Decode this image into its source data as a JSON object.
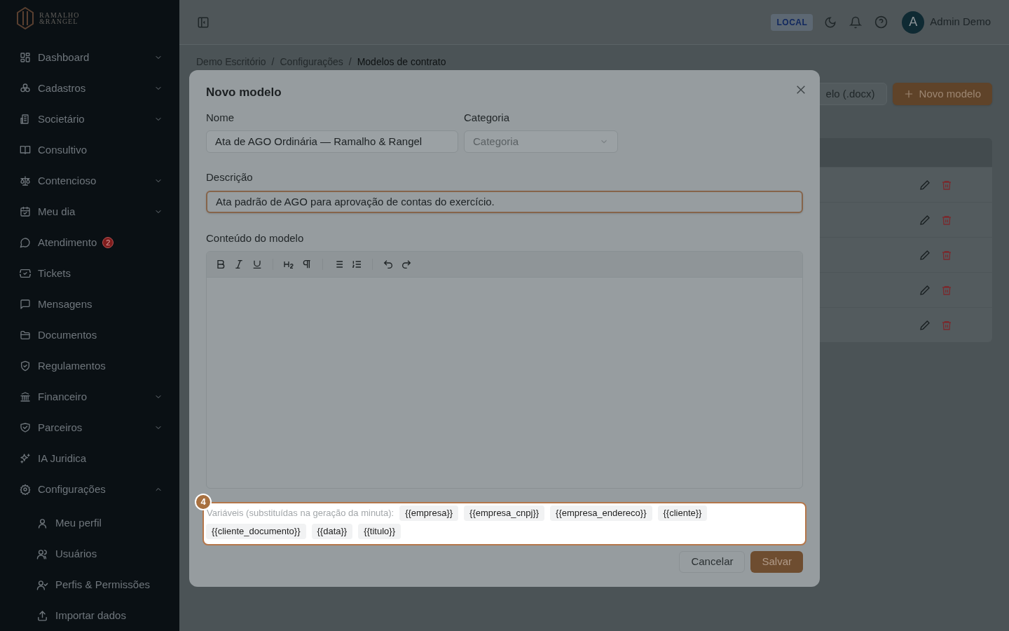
{
  "sidebar": {
    "logo": {
      "line1": "RAMALHO",
      "line2": "&RANGEL"
    },
    "items": [
      {
        "label": "Dashboard",
        "kind": "group",
        "expanded": false
      },
      {
        "label": "Cadastros",
        "kind": "group",
        "expanded": false
      },
      {
        "label": "Societário",
        "kind": "group",
        "expanded": false
      },
      {
        "label": "Consultivo",
        "kind": "link"
      },
      {
        "label": "Contencioso",
        "kind": "group",
        "expanded": false
      },
      {
        "label": "Meu dia",
        "kind": "group",
        "expanded": false
      },
      {
        "label": "Atendimento",
        "kind": "link",
        "badge": "2"
      },
      {
        "label": "Tickets",
        "kind": "link"
      },
      {
        "label": "Mensagens",
        "kind": "link"
      },
      {
        "label": "Documentos",
        "kind": "link"
      },
      {
        "label": "Regulamentos",
        "kind": "link"
      },
      {
        "label": "Financeiro",
        "kind": "group",
        "expanded": false
      },
      {
        "label": "Parceiros",
        "kind": "group",
        "expanded": false
      },
      {
        "label": "IA Juridica",
        "kind": "link"
      },
      {
        "label": "Configurações",
        "kind": "group",
        "expanded": true,
        "children": [
          {
            "label": "Meu perfil"
          },
          {
            "label": "Usuários"
          },
          {
            "label": "Perfis & Permissões"
          },
          {
            "label": "Importar dados"
          }
        ]
      }
    ]
  },
  "topbar": {
    "environment": "LOCAL",
    "user": {
      "initial": "A",
      "name": "Admin Demo"
    }
  },
  "breadcrumb": [
    {
      "label": "Demo Escritório",
      "kind": "link"
    },
    {
      "label": "/",
      "kind": "separator"
    },
    {
      "label": "Configurações",
      "kind": "link"
    },
    {
      "label": "/",
      "kind": "separator"
    },
    {
      "label": "Modelos de contrato",
      "kind": "current"
    }
  ],
  "actions": [
    {
      "label": "elo (.docx)",
      "kind": "secondary"
    },
    {
      "label": "Novo modelo",
      "kind": "primary"
    }
  ],
  "table": {
    "rows": [
      {
        "kind": "data"
      },
      {
        "kind": "data"
      },
      {
        "kind": "data"
      },
      {
        "kind": "data"
      },
      {
        "kind": "data"
      }
    ]
  },
  "modal": {
    "title": "Novo modelo",
    "name": {
      "label": "Nome",
      "value": "Ata de AGO Ordinária — Ramalho & Rangel"
    },
    "category": {
      "label": "Categoria",
      "placeholder": "Categoria"
    },
    "description": {
      "label": "Descrição",
      "value": "Ata padrão de AGO para aprovação de contas do exercício.",
      "focused": true
    },
    "content": {
      "label": "Conteúdo do modelo"
    },
    "variables": {
      "tour_step": "4",
      "label": "Variáveis (substituídas na geração da minuta):",
      "tokens": [
        "{{empresa}}",
        "{{empresa_cnpj}}",
        "{{empresa_endereco}}",
        "{{cliente}}",
        "{{cliente_documento}}",
        "{{data}}",
        "{{titulo}}"
      ]
    },
    "buttons": [
      {
        "label": "Cancelar",
        "kind": "secondary"
      },
      {
        "label": "Salvar",
        "kind": "primary"
      }
    ]
  }
}
